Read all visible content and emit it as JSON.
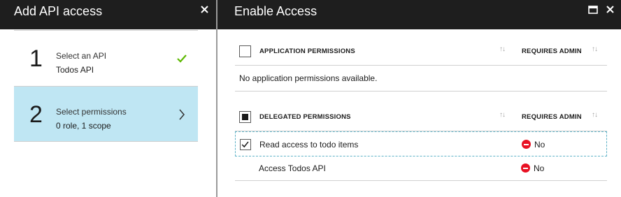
{
  "left_blade": {
    "title": "Add API access",
    "close_icon": "close-icon",
    "steps": [
      {
        "number": "1",
        "label": "Select an API",
        "value": "Todos API",
        "state": "complete",
        "status_icon": "checkmark-icon",
        "status_color": "#5cb800"
      },
      {
        "number": "2",
        "label": "Select permissions",
        "value": "0 role, 1 scope",
        "state": "active",
        "status_icon": "chevron-right-icon"
      }
    ]
  },
  "right_blade": {
    "title": "Enable Access",
    "maximize_icon": "maximize-icon",
    "close_icon": "close-icon",
    "application_permissions": {
      "header": "APPLICATION PERMISSIONS",
      "admin_header": "REQUIRES ADMIN",
      "select_all": "unchecked",
      "empty_message": "No application permissions available."
    },
    "delegated_permissions": {
      "header": "DELEGATED PERMISSIONS",
      "admin_header": "REQUIRES ADMIN",
      "select_all": "partial",
      "rows": [
        {
          "name": "Read access to todo items",
          "requires_admin": "No",
          "checked": true,
          "admin_icon": "no-entry-icon"
        },
        {
          "name": "Access Todos API",
          "requires_admin": "No",
          "checked": false,
          "admin_icon": "no-entry-icon"
        }
      ]
    }
  },
  "colors": {
    "header_bg": "#1e1e1e",
    "active_step_bg": "#bfe6f3",
    "check_green": "#5cb800",
    "no_entry_red": "#e81123",
    "selected_row_border": "#5fb3c8"
  }
}
